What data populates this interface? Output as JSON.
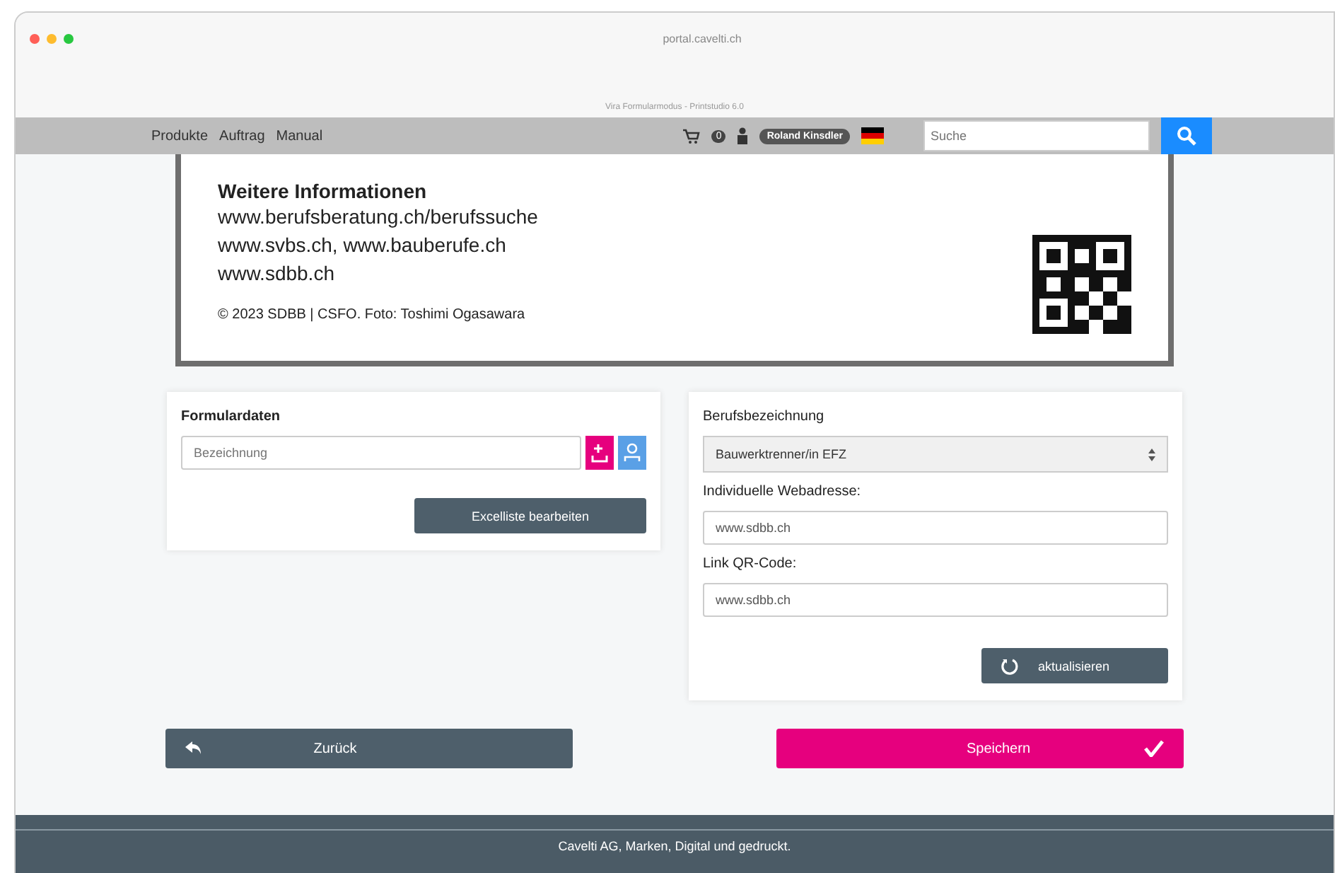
{
  "browser": {
    "address": "portal.cavelti.ch",
    "tab_title": "Vira Formularmodus - Printstudio 6.0"
  },
  "nav": {
    "links": [
      "Produkte",
      "Auftrag",
      "Manual"
    ],
    "cart_count": "0",
    "user": "Roland Kinsdler",
    "search": {
      "placeholder": "Suche"
    }
  },
  "preview": {
    "heading": "Weitere Informationen",
    "lines": [
      "www.berufsberatung.ch/berufssuche",
      "www.svbs.ch, www.bauberufe.ch",
      "www.sdbb.ch"
    ],
    "credit": "© 2023 SDBB | CSFO.  Foto: Toshimi Ogasawara"
  },
  "form_data": {
    "title": "Formulardaten",
    "field": {
      "placeholder": "Bezeichnung"
    },
    "button": "Excelliste bearbeiten"
  },
  "settings": {
    "job_label": "Berufsbezeichnung",
    "job_value": "Bauwerktrenner/in EFZ",
    "web_label": "Individuelle Webadresse:",
    "web_value": "www.sdbb.ch",
    "qr_label": "Link QR-Code:",
    "qr_value": "www.sdbb.ch",
    "refresh": "aktualisieren"
  },
  "actions": {
    "back": "Zurück",
    "save": "Speichern"
  },
  "footer": "Cavelti AG, Marken, Digital und gedruckt."
}
